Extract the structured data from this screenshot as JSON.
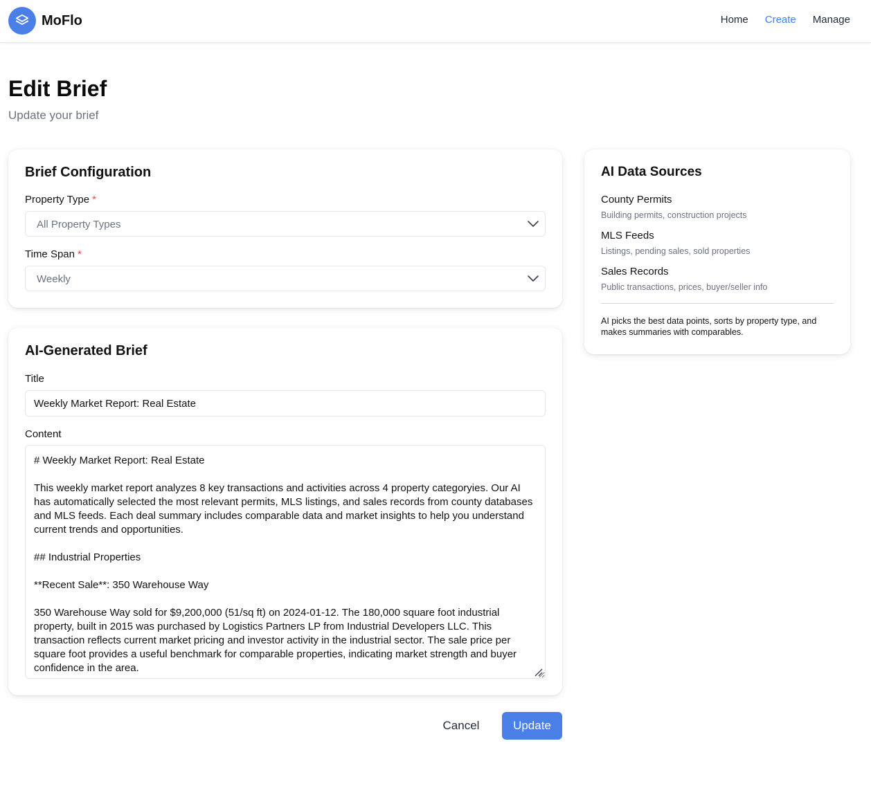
{
  "app": {
    "name": "MoFlo",
    "colors": {
      "accent": "#4a7fe8",
      "required": "#ef4444",
      "active_nav": "#3b82f6"
    }
  },
  "nav": {
    "items": [
      {
        "label": "Home",
        "active": false
      },
      {
        "label": "Create",
        "active": true
      },
      {
        "label": "Manage",
        "active": false
      }
    ]
  },
  "page": {
    "title": "Edit Brief",
    "subtitle": "Update your brief"
  },
  "config": {
    "title": "Brief Configuration",
    "property_type": {
      "label": "Property Type",
      "required": "*",
      "value": "All Property Types"
    },
    "time_span": {
      "label": "Time Span",
      "required": "*",
      "value": "Weekly"
    }
  },
  "brief": {
    "title": "AI-Generated Brief",
    "title_field": {
      "label": "Title",
      "value": "Weekly Market Report: Real Estate"
    },
    "content_field": {
      "label": "Content",
      "value": "# Weekly Market Report: Real Estate\n\nThis weekly market report analyzes 8 key transactions and activities across 4 property categoryies. Our AI has automatically selected the most relevant permits, MLS listings, and sales records from county databases and MLS feeds. Each deal summary includes comparable data and market insights to help you understand current trends and opportunities.\n\n## Industrial Properties\n\n**Recent Sale**: 350 Warehouse Way\n\n350 Warehouse Way sold for $9,200,000 (51/sq ft) on 2024-01-12. The 180,000 square foot industrial property, built in 2015 was purchased by Logistics Partners LP from Industrial Developers LLC. This transaction reflects current market pricing and investor activity in the industrial sector. The sale price per square foot provides a useful benchmark for comparable properties, indicating market strength and buyer confidence in the area."
    }
  },
  "sources": {
    "title": "AI Data Sources",
    "items": [
      {
        "name": "County Permits",
        "desc": "Building permits, construction projects"
      },
      {
        "name": "MLS Feeds",
        "desc": "Listings, pending sales, sold properties"
      },
      {
        "name": "Sales Records",
        "desc": "Public transactions, prices, buyer/seller info"
      }
    ],
    "note": "AI picks the best data points, sorts by property type, and makes summaries with comparables."
  },
  "actions": {
    "cancel": "Cancel",
    "update": "Update"
  }
}
